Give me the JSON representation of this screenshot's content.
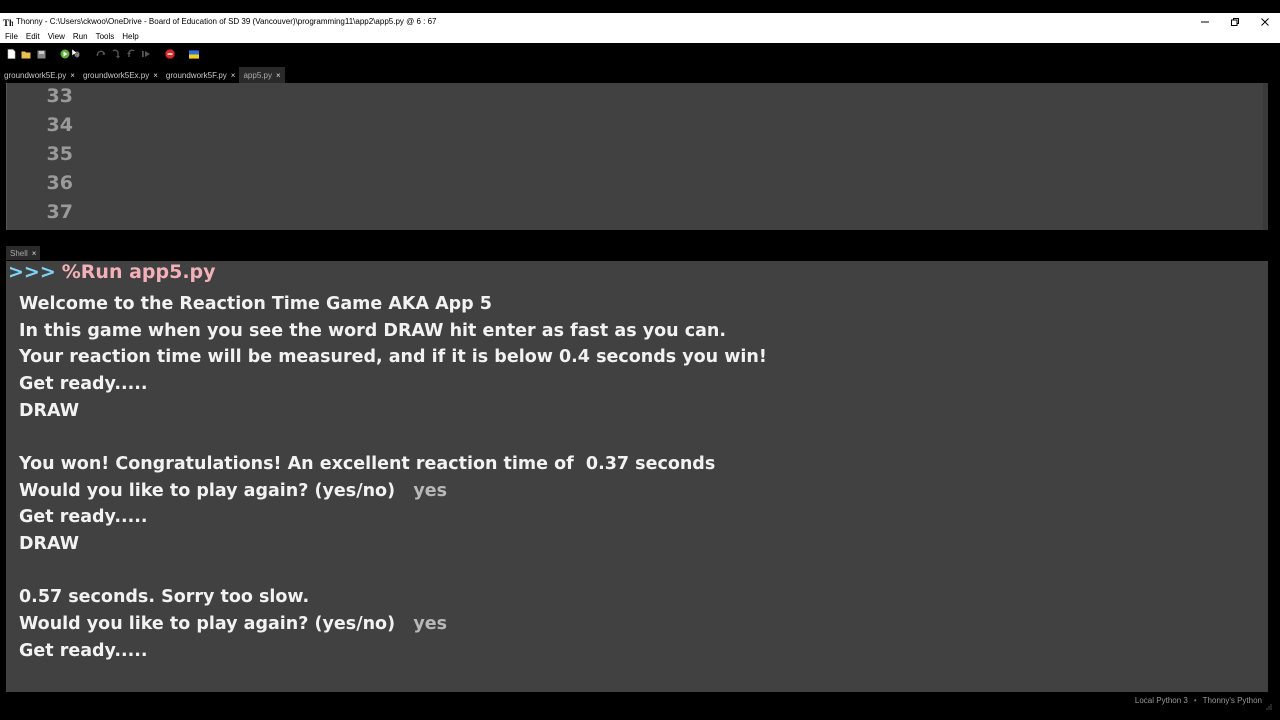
{
  "window": {
    "title": "Thonny  -  C:\\Users\\ckwoo\\OneDrive - Board of Education of SD 39 (Vancouver)\\programming11\\app2\\app5.py  @  6 : 67"
  },
  "menu": [
    "File",
    "Edit",
    "View",
    "Run",
    "Tools",
    "Help"
  ],
  "tabs": [
    {
      "label": "groundwork5E.py",
      "active": false
    },
    {
      "label": "groundwork5Ex.py",
      "active": false
    },
    {
      "label": "groundwork5F.py",
      "active": false
    },
    {
      "label": "app5.py",
      "active": true
    }
  ],
  "editor": {
    "line_numbers": [
      "33",
      "34",
      "35",
      "36",
      "37"
    ]
  },
  "shell": {
    "tab_label": "Shell",
    "prompt": ">>>",
    "command": "%Run app5.py",
    "lines": [
      {
        "text": "Welcome to the Reaction Time Game AKA App 5",
        "input": ""
      },
      {
        "text": "In this game when you see the word DRAW hit enter as fast as you can.",
        "input": ""
      },
      {
        "text": "Your reaction time will be measured, and if it is below 0.4 seconds you win!",
        "input": ""
      },
      {
        "text": "Get ready.....",
        "input": ""
      },
      {
        "text": "DRAW",
        "input": ""
      },
      {
        "text": "",
        "input": ""
      },
      {
        "text": "You won! Congratulations! An excellent reaction time of  0.37 seconds",
        "input": ""
      },
      {
        "text": "Would you like to play again? (yes/no)   ",
        "input": "yes"
      },
      {
        "text": "Get ready.....",
        "input": ""
      },
      {
        "text": "DRAW",
        "input": ""
      },
      {
        "text": "",
        "input": ""
      },
      {
        "text": "0.57 seconds. Sorry too slow.",
        "input": ""
      },
      {
        "text": "Would you like to play again? (yes/no)   ",
        "input": "yes"
      },
      {
        "text": "Get ready.....",
        "input": ""
      }
    ]
  },
  "status": {
    "interpreter": "Local Python 3",
    "separator": "•",
    "backend": "Thonny's Python"
  },
  "colors": {
    "panel_bg": "#414141",
    "prompt_chevron": "#7ed3f5",
    "command_text": "#f4b0b8",
    "output_text": "#f2f2f2",
    "user_input": "#b8b8b8"
  }
}
